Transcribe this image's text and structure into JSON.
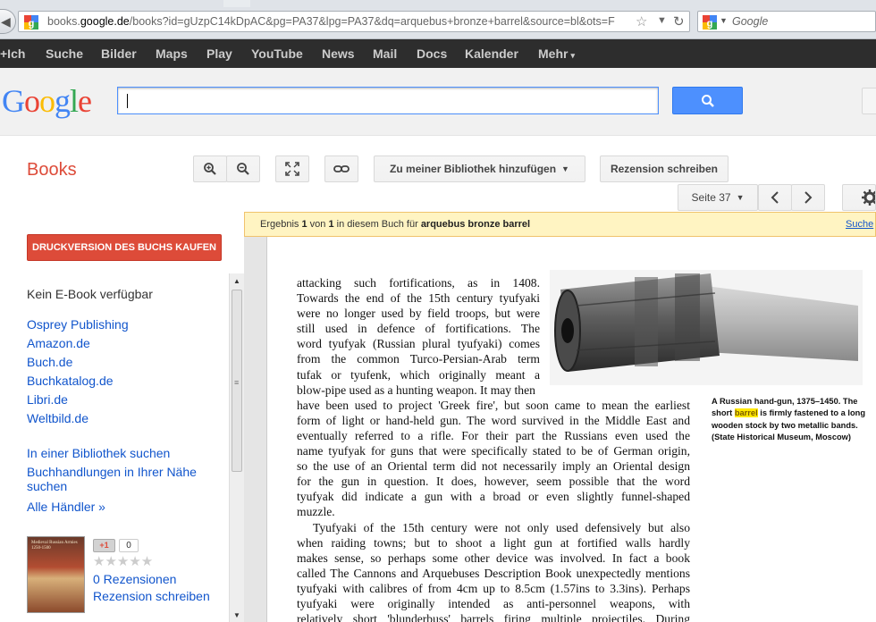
{
  "browser": {
    "url_prefix": "books.",
    "url_domain": "google.de",
    "url_path": "/books?id=gUzpC14kDpAC&pg=PA37&lpg=PA37&dq=arquebus+bronze+barrel&source=bl&ots=F",
    "search_placeholder": "Google"
  },
  "gbar": {
    "items": [
      "+Ich",
      "Suche",
      "Bilder",
      "Maps",
      "Play",
      "YouTube",
      "News",
      "Mail",
      "Docs",
      "Kalender",
      "Mehr"
    ]
  },
  "header": {
    "logo": "Google",
    "search_value": ""
  },
  "books": {
    "title": "Books",
    "add_library": "Zu meiner Bibliothek hinzufügen",
    "write_review": "Rezension schreiben",
    "page_select": "Seite 37"
  },
  "sidebar": {
    "buy_button": "DRUCKVERSION DES BUCHS KAUFEN",
    "no_ebook": "Kein E-Book verfügbar",
    "shops": [
      "Osprey Publishing",
      "Amazon.de",
      "Buch.de",
      "Buchkatalog.de",
      "Libri.de",
      "Weltbild.de"
    ],
    "library_search": "In einer Bibliothek suchen",
    "nearby_line1": "Buchhandlungen in Ihrer Nähe",
    "nearby_line2": "suchen",
    "all_dealers": "Alle Händler »",
    "cover_title": "Medieval Russian Armies 1250-1500",
    "gplus_label": "+1",
    "gplus_count": "0",
    "stars": "★★★★★",
    "reviews_count": "0 Rezensionen",
    "write_review": "Rezension schreiben"
  },
  "result": {
    "prefix": "Ergebnis ",
    "num": "1",
    "mid": " von ",
    "total": "1",
    "suffix": " in diesem Buch für ",
    "query": "arquebus bronze barrel",
    "search_link": "Suche"
  },
  "page": {
    "narrow_lines": [
      "attacking such fortifications, as in 1408.",
      "Towards the end of the 15th century tyufyaki",
      "were no longer used by field troops, but were",
      "still used in defence of fortifications. The",
      "word tyufyak (Russian plural tyufyaki) comes",
      "from the common Turco-Persian-Arab term",
      "tufak or tyufenk, which originally meant a",
      "blow-pipe used as a hunting weapon. It may then"
    ],
    "wide_lines": [
      "have been used to project 'Greek fire', but soon came to mean the earliest",
      "form of light or hand-held gun. The word survived in the Middle East and",
      "eventually referred to a rifle. For their part the Russians even used the",
      "name tyufyak for guns that were specifically stated to be of German origin,",
      "so the use of an Oriental term did not necessarily imply an Oriental design",
      "for the gun in question. It does, however, seem possible that the word",
      "tyufyak did indicate a gun with a broad or even slightly funnel-shaped",
      "muzzle.",
      "Tyufyaki of the 15th century were not only used defensively but also",
      "when raiding towns; but to shoot a light gun at fortified walls hardly",
      "makes sense, so perhaps some other device was involved. In fact a book",
      "called The Cannons and Arquebuses Description Book unexpectedly mentions",
      "tyufyaki with calibres of from 4cm up to 8.5cm (1.57ins to 3.3ins). Perhaps",
      "tyufyaki were originally intended as anti-personnel weapons, with",
      "relatively short 'blunderbuss' barrels firing multiple projectiles. During"
    ],
    "caption": {
      "part1": "A Russian hand-gun, 1375–1450. The short ",
      "highlight": "barrel",
      "part2": " is firmly fastened to a long wooden stock by two metallic bands. (State Historical Museum, Moscow)"
    }
  },
  "colors": {
    "accent_red": "#dd4b39",
    "link_blue": "#1155cc",
    "search_blue": "#4d90fe",
    "gbar_bg": "#2d2d2d",
    "result_bg": "#fff4c2"
  }
}
